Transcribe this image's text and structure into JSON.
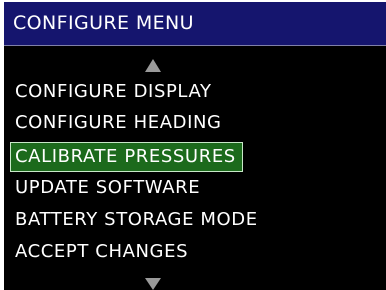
{
  "header": {
    "title": "CONFIGURE MENU"
  },
  "scroll_indicators": {
    "up_icon": "triangle-up-icon",
    "down_icon": "triangle-down-icon"
  },
  "menu": {
    "selected_index": 2,
    "items": [
      {
        "label": "CONFIGURE DISPLAY"
      },
      {
        "label": "CONFIGURE HEADING"
      },
      {
        "label": "CALIBRATE PRESSURES"
      },
      {
        "label": "UPDATE SOFTWARE"
      },
      {
        "label": "BATTERY STORAGE MODE"
      },
      {
        "label": "ACCEPT CHANGES"
      }
    ]
  },
  "colors": {
    "title_bar": "#15156e",
    "background": "#000000",
    "selection": "#1c6a1c",
    "text": "#ffffff",
    "arrow": "#9a9a9a"
  }
}
